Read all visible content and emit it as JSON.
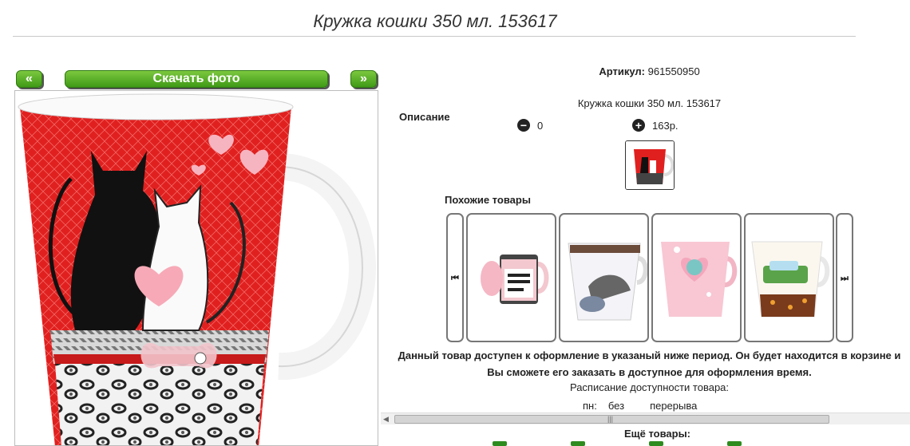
{
  "page": {
    "title": "Кружка кошки 350 мл. 153617"
  },
  "photo_nav": {
    "prev_label": "«",
    "download_label": "Скачать фото",
    "next_label": "»"
  },
  "product": {
    "article_label": "Артикул:",
    "article_value": "961550950",
    "description_label": "Описание",
    "description_text": "Кружка кошки 350 мл. 153617",
    "minus_icon": "minus-circle-icon",
    "minus_value": "0",
    "plus_icon": "plus-circle-icon",
    "plus_value": "163р."
  },
  "similar": {
    "label": "Похожие товары",
    "prev_icon": "skip-back-icon",
    "next_icon": "skip-forward-icon",
    "items": [
      {
        "name": "self-stirring-mug"
      },
      {
        "name": "fashion-mug"
      },
      {
        "name": "pink-heart-mug"
      },
      {
        "name": "car-print-mug"
      }
    ]
  },
  "availability": {
    "notice": "Данный товар доступен к оформление в указаный ниже период. Он будет находится в корзине и Вы сможете его заказать в доступное для оформления время.",
    "schedule_title": "Расписание доступности товара:",
    "schedule_day": "пн:",
    "schedule_col1": "без",
    "schedule_col2": "перерыва"
  },
  "more": {
    "label": "Ещё товары:"
  },
  "colors": {
    "button_green": "#4ea81f",
    "mug_red": "#e0201f"
  }
}
